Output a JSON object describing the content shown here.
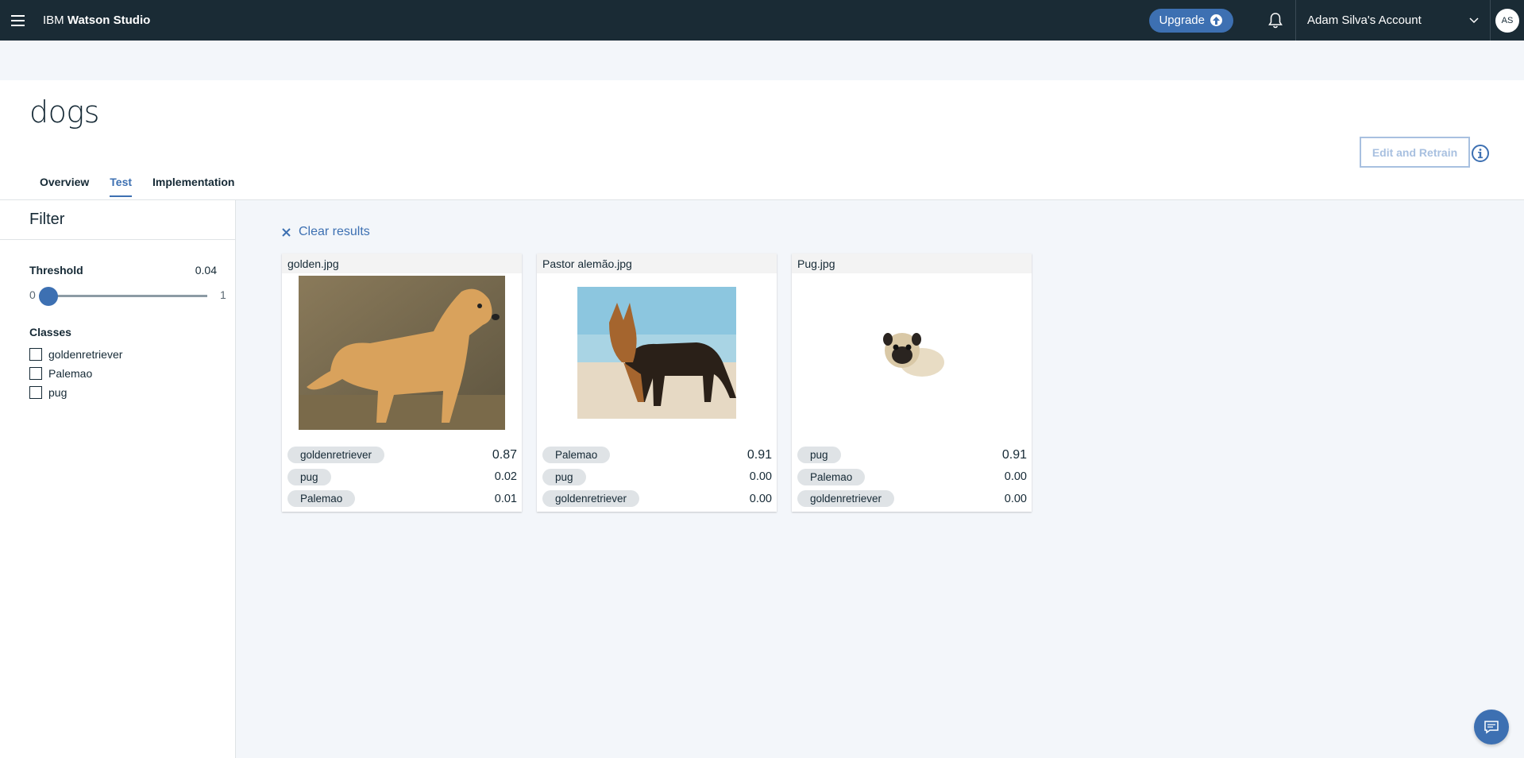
{
  "topbar": {
    "brand_prefix": "IBM",
    "brand_name": "Watson Studio",
    "upgrade_label": "Upgrade",
    "account_label": "Adam Silva's Account",
    "avatar_initials": "AS"
  },
  "page": {
    "title": "dogs",
    "tabs": [
      {
        "label": "Overview"
      },
      {
        "label": "Test",
        "active": true
      },
      {
        "label": "Implementation"
      }
    ],
    "edit_retrain_label": "Edit and Retrain"
  },
  "sidebar": {
    "filter_title": "Filter",
    "threshold_label": "Threshold",
    "threshold_value": "0.04",
    "slider_min": "0",
    "slider_max": "1",
    "classes_title": "Classes",
    "classes": [
      {
        "label": "goldenretriever",
        "checked": false
      },
      {
        "label": "Palemao",
        "checked": false
      },
      {
        "label": "pug",
        "checked": false
      }
    ]
  },
  "main": {
    "clear_results_label": "Clear results",
    "cards": [
      {
        "filename": "golden.jpg",
        "image": "golden-retriever-photo",
        "results": [
          {
            "class": "goldenretriever",
            "score": "0.87"
          },
          {
            "class": "pug",
            "score": "0.02"
          },
          {
            "class": "Palemao",
            "score": "0.01"
          }
        ]
      },
      {
        "filename": "Pastor alemão.jpg",
        "image": "german-shepherd-photo",
        "results": [
          {
            "class": "Palemao",
            "score": "0.91"
          },
          {
            "class": "pug",
            "score": "0.00"
          },
          {
            "class": "goldenretriever",
            "score": "0.00"
          }
        ]
      },
      {
        "filename": "Pug.jpg",
        "image": "pug-photo",
        "results": [
          {
            "class": "pug",
            "score": "0.91"
          },
          {
            "class": "Palemao",
            "score": "0.00"
          },
          {
            "class": "goldenretriever",
            "score": "0.00"
          }
        ]
      }
    ]
  },
  "colors": {
    "topbar_bg": "#1a2b35",
    "accent": "#3d70b2",
    "page_bg": "#f3f6fa"
  },
  "icons": {
    "menu": "hamburger-icon",
    "upgrade": "arrow-up-icon",
    "notifications": "bell-icon",
    "account_dropdown": "chevron-down-icon",
    "info": "info-icon",
    "clear": "close-icon",
    "chat": "chat-icon"
  }
}
